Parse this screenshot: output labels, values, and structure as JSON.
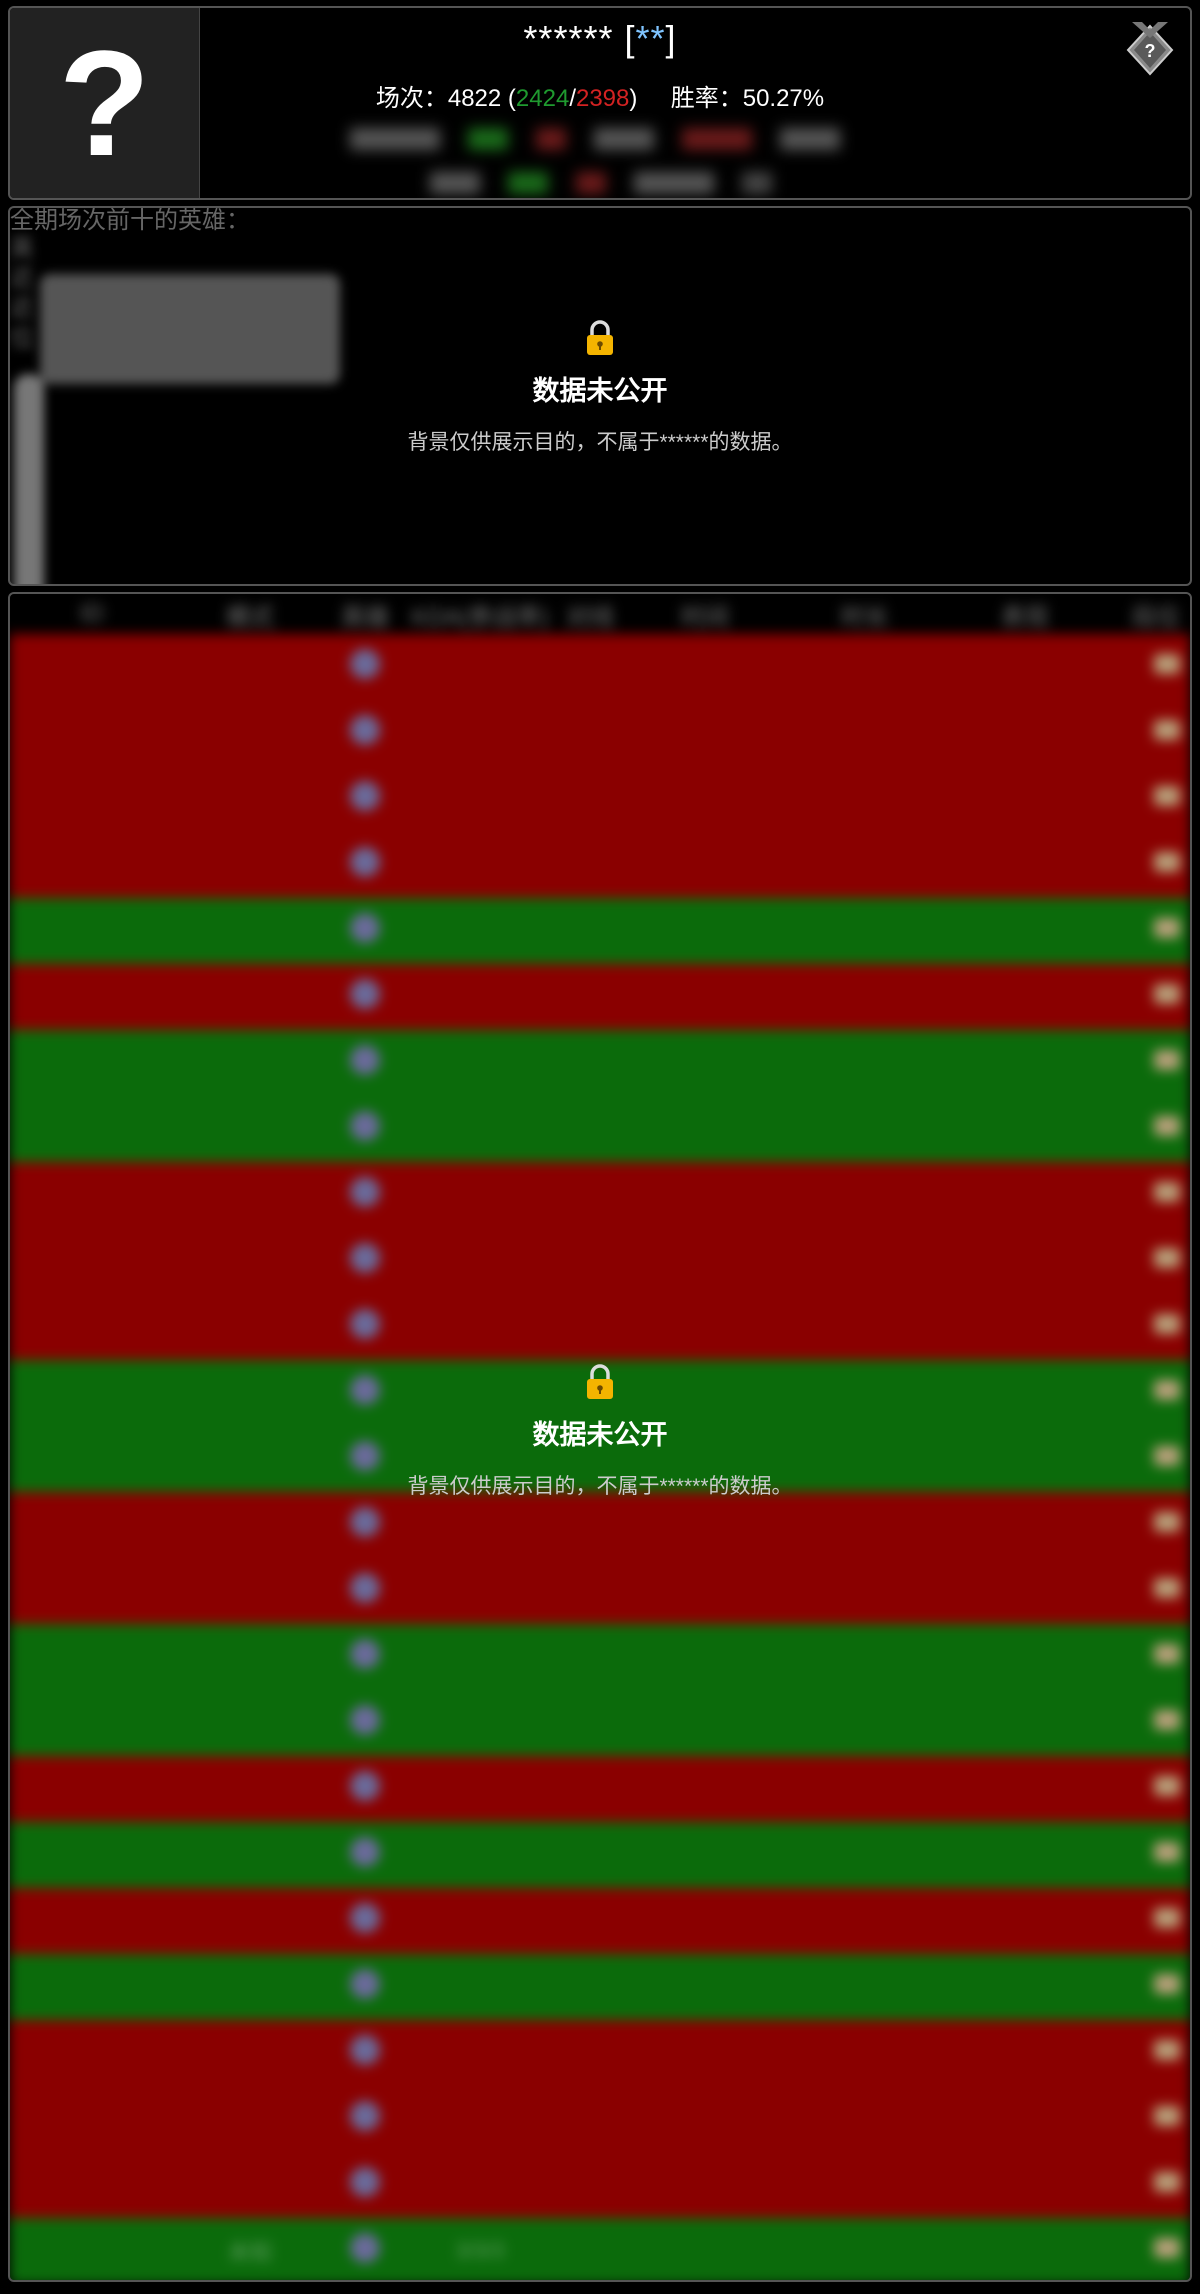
{
  "header": {
    "player_name": "******",
    "player_tag": "**",
    "stats_label": "场次：",
    "games": "4822",
    "wins": "2424",
    "losses": "2398",
    "winrate_label": "胜率：",
    "winrate": "50.27%",
    "avatar_glyph": "?",
    "rank_icon": "unknown-rank-icon"
  },
  "champion_panel": {
    "background_lines": [
      "全期场次前十的英雄：",
      "英",
      "近",
      "近",
      "位"
    ],
    "lock": {
      "title": "数据未公开",
      "subtitle": "背景仅供展示目的，不属于******的数据。"
    }
  },
  "match_panel": {
    "columns": [
      "ID",
      "模式",
      "英雄",
      "KDA(参战率)",
      "对线",
      "时间",
      "时长",
      "表现",
      "段位"
    ],
    "rows": [
      "loss",
      "loss",
      "loss",
      "loss",
      "win",
      "loss",
      "win",
      "win",
      "loss",
      "loss",
      "loss",
      "win",
      "win",
      "loss",
      "loss",
      "win",
      "win",
      "loss",
      "win",
      "loss",
      "win",
      "loss",
      "loss",
      "loss",
      "win"
    ],
    "last_row": {
      "mode": "未知",
      "kda": "3/3/3"
    },
    "lock": {
      "title": "数据未公开",
      "subtitle": "背景仅供展示目的，不属于******的数据。"
    }
  },
  "colors": {
    "win": "#1f9a2f",
    "loss": "#d32222",
    "win_row": "#0b6b0b",
    "loss_row": "#8a0000"
  }
}
